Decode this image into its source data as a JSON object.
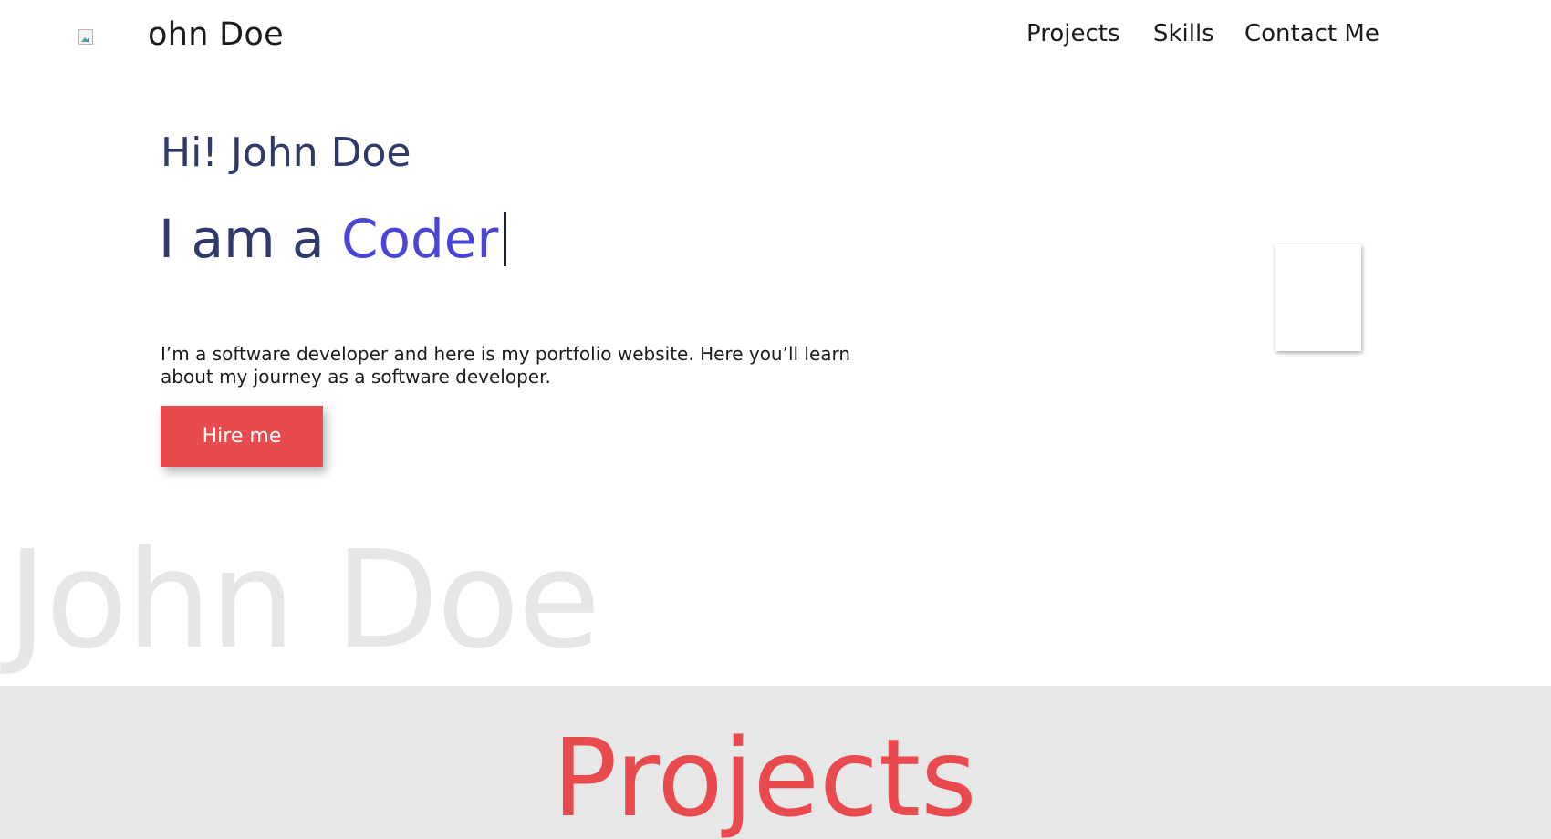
{
  "header": {
    "logo_text": "ohn Doe",
    "nav": [
      {
        "label": "Projects"
      },
      {
        "label": "Skills"
      },
      {
        "label": "Contact Me"
      }
    ]
  },
  "hero": {
    "greeting": "Hi! John Doe",
    "tagline_prefix": "I am a ",
    "role": "Coder",
    "intro": "I’m a software developer and here is my portfolio website. Here you’ll learn about my journey as a software developer.",
    "hire_label": "Hire me",
    "watermark": "John Doe"
  },
  "projects": {
    "title": "Projects"
  },
  "colors": {
    "accent_red": "#e84a4d",
    "accent_purple": "#4b45d4",
    "heading_navy": "#2f3a6b",
    "section_gray": "#e7e7e8",
    "watermark_gray": "#e6e6e6"
  },
  "icons": {
    "logo": "broken-image-icon"
  }
}
